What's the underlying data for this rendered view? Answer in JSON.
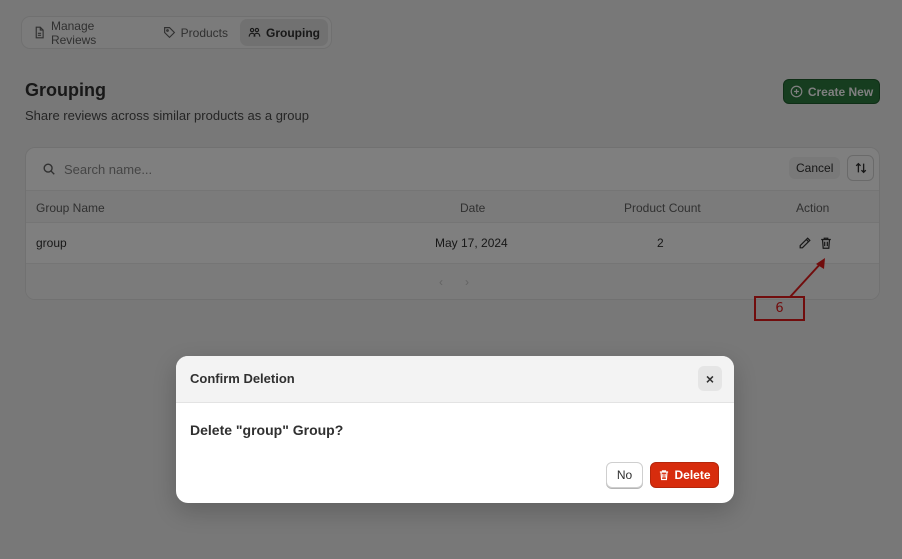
{
  "nav": {
    "tabs": [
      {
        "label": "Manage Reviews",
        "icon": "document-icon",
        "active": false
      },
      {
        "label": "Products",
        "icon": "tag-icon",
        "active": false
      },
      {
        "label": "Grouping",
        "icon": "people-icon",
        "active": true
      }
    ]
  },
  "header": {
    "title": "Grouping",
    "subtitle": "Share reviews across similar products as a group",
    "create_label": "Create New"
  },
  "search": {
    "placeholder": "Search name...",
    "cancel_label": "Cancel"
  },
  "table": {
    "columns": [
      "Group Name",
      "Date",
      "Product Count",
      "Action"
    ],
    "rows": [
      {
        "name": "group",
        "date": "May 17, 2024",
        "count": "2"
      }
    ]
  },
  "pager": {
    "prev": "‹",
    "next": "›"
  },
  "annotation": {
    "label": "6",
    "color": "#e21b1b"
  },
  "modal": {
    "title": "Confirm Deletion",
    "close": "×",
    "message": "Delete \"group\" Group?",
    "no_label": "No",
    "delete_label": "Delete"
  },
  "colors": {
    "primary": "#2c7a3e",
    "danger": "#d72c0d",
    "overlay": "rgba(0,0,0,0.5)"
  }
}
